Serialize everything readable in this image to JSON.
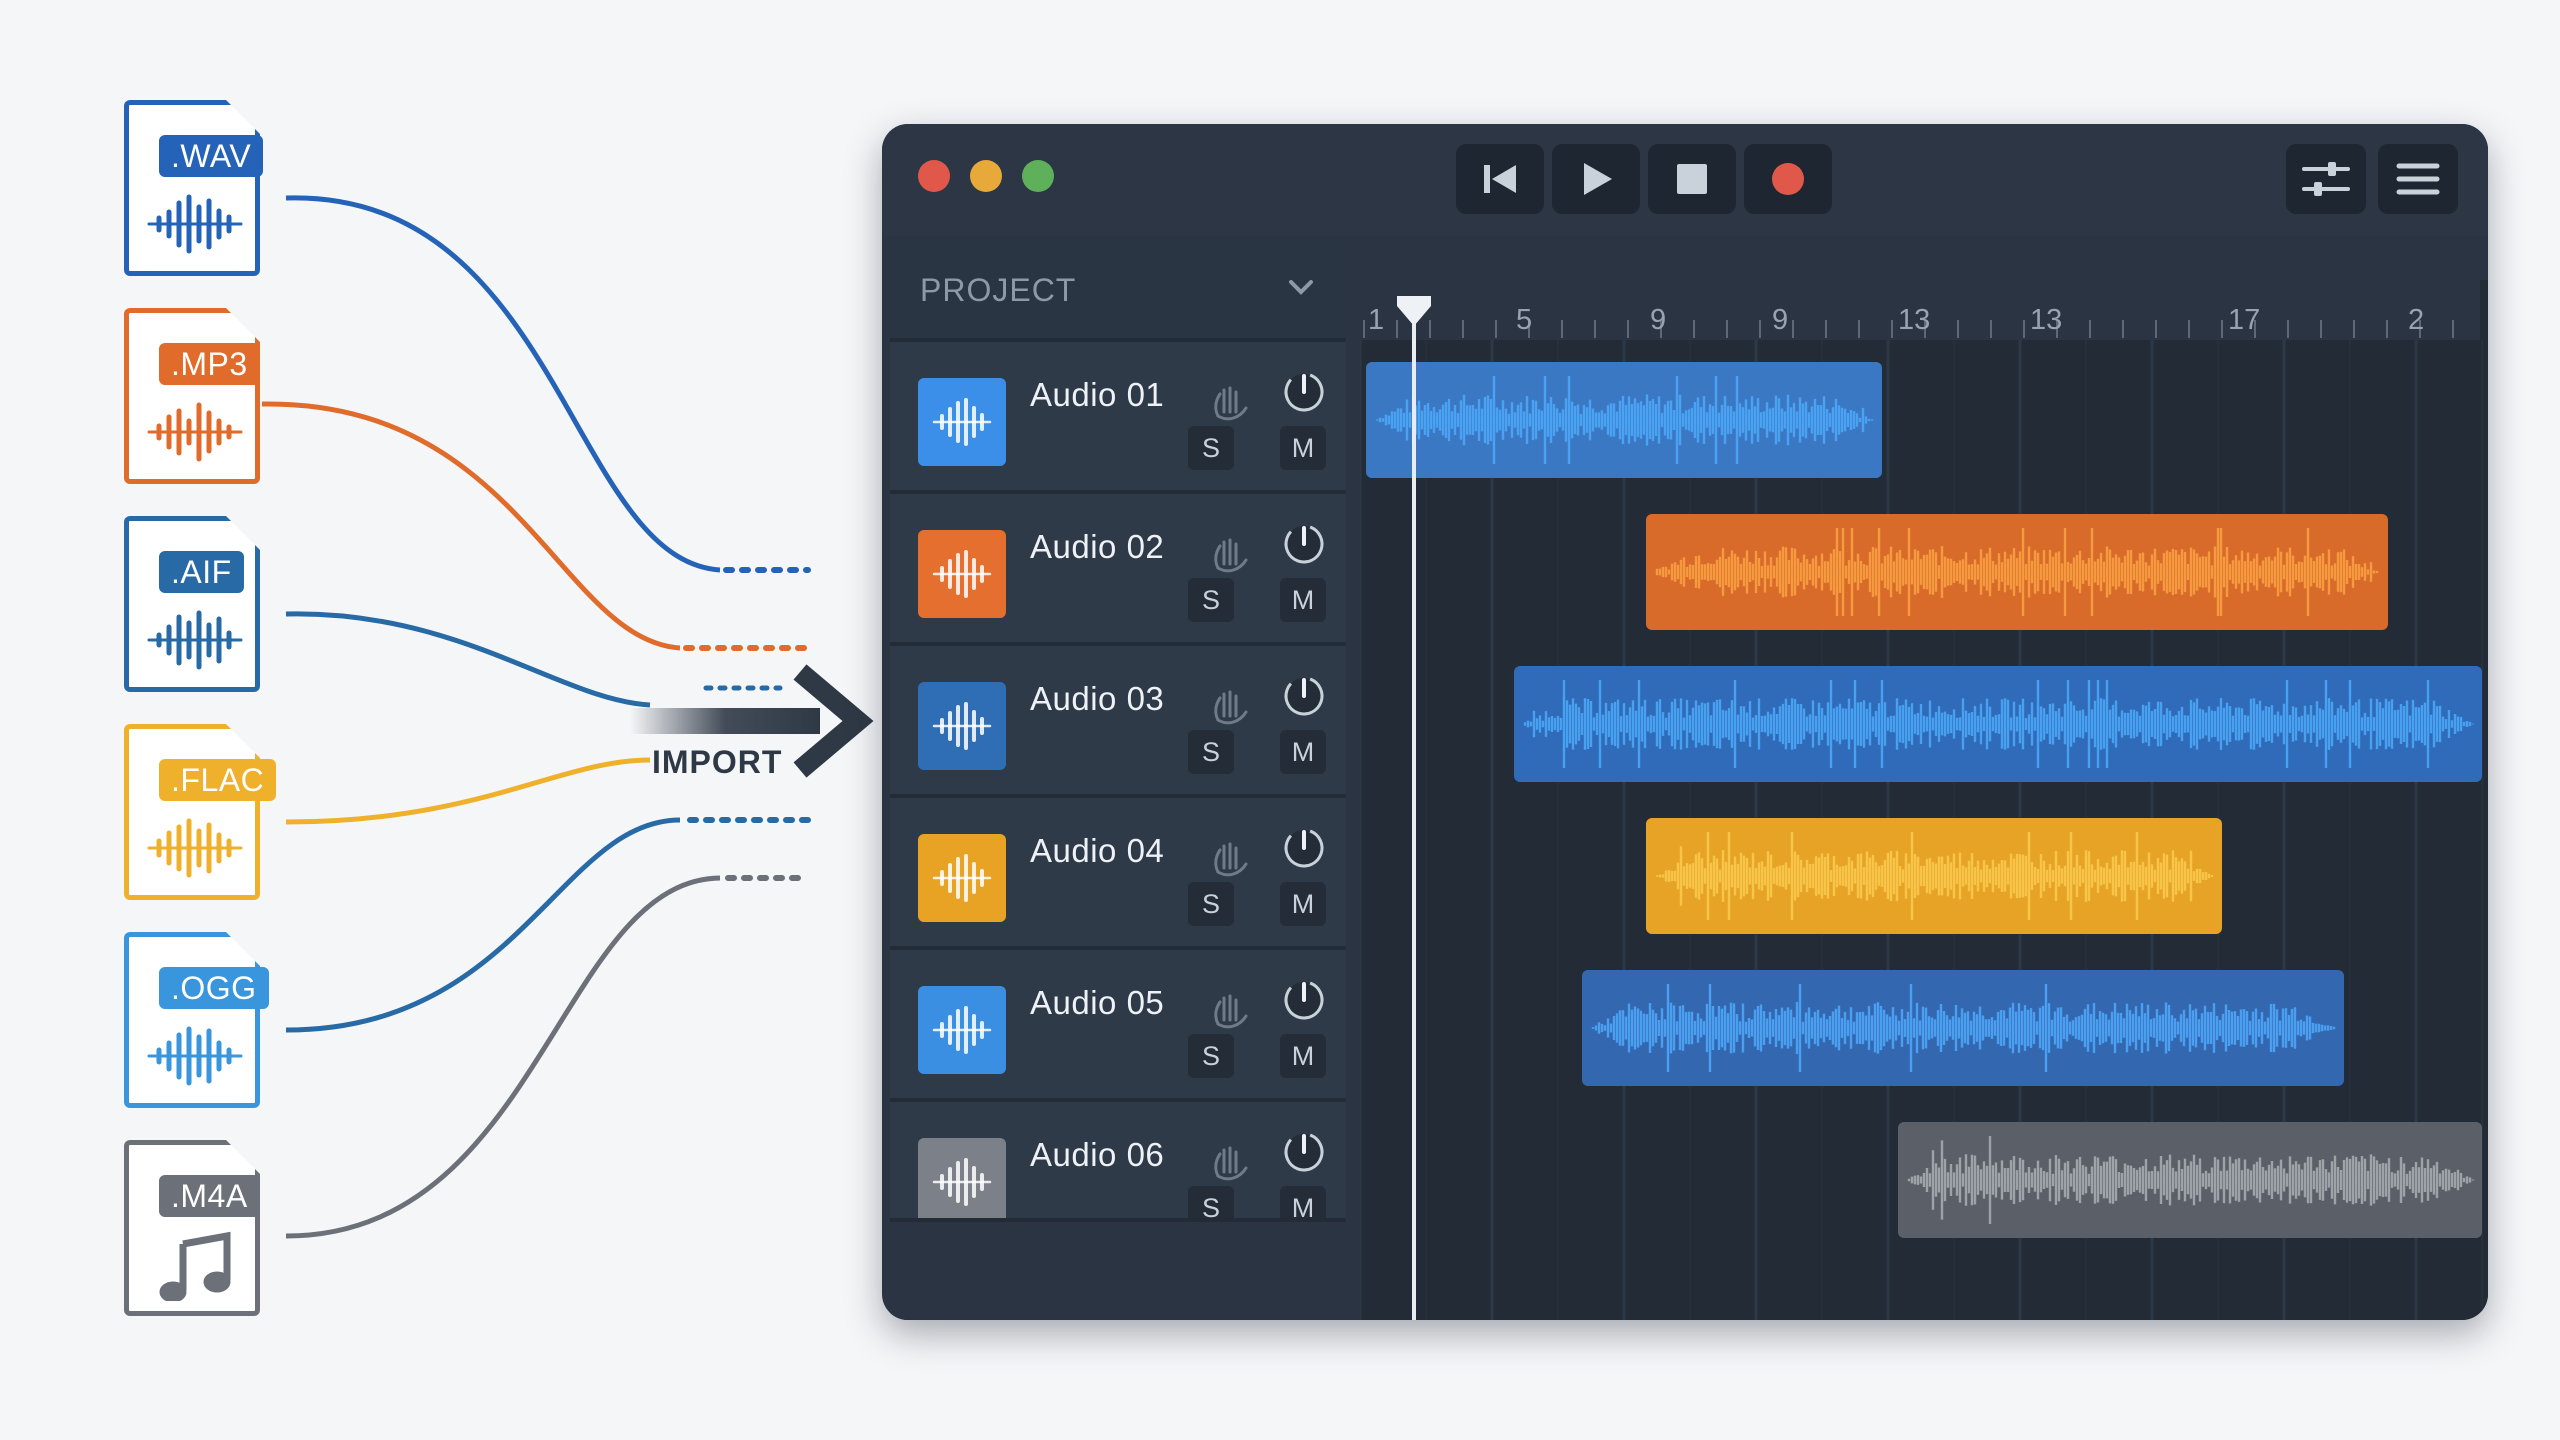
{
  "files": [
    {
      "ext": ".WAV",
      "color": "#2563b8",
      "icon": "waveform-icon"
    },
    {
      "ext": ".MP3",
      "color": "#e06b2a",
      "icon": "waveform-icon"
    },
    {
      "ext": ".AIF",
      "color": "#276aa6",
      "icon": "waveform-icon"
    },
    {
      "ext": ".FLAC",
      "color": "#efb02c",
      "icon": "waveform-icon"
    },
    {
      "ext": ".OGG",
      "color": "#3a96dc",
      "icon": "waveform-icon"
    },
    {
      "ext": ".M4A",
      "color": "#6b7079",
      "icon": "music-note-icon"
    }
  ],
  "import_label": "IMPORT",
  "window": {
    "transport": [
      "skip-back-icon",
      "play-icon",
      "stop-icon",
      "record-icon"
    ],
    "toolbar_right": [
      "sliders-icon",
      "menu-icon"
    ],
    "sidebar": {
      "header": "PROJECT",
      "tracks": [
        {
          "name": "Audio 01",
          "solo": "S",
          "mute": "M",
          "color": "#3b8fe8"
        },
        {
          "name": "Audio 02",
          "solo": "S",
          "mute": "M",
          "color": "#e46f2e"
        },
        {
          "name": "Audio 03",
          "solo": "S",
          "mute": "M",
          "color": "#2f6eb5"
        },
        {
          "name": "Audio 04",
          "solo": "S",
          "mute": "M",
          "color": "#e9a324"
        },
        {
          "name": "Audio 05",
          "solo": "S",
          "mute": "M",
          "color": "#3a8fe3"
        },
        {
          "name": "Audio 06",
          "solo": "S",
          "mute": "M",
          "color": "#7c8088"
        }
      ]
    },
    "ruler": [
      "1",
      "5",
      "9",
      "9",
      "13",
      "13",
      "17",
      "2"
    ]
  }
}
